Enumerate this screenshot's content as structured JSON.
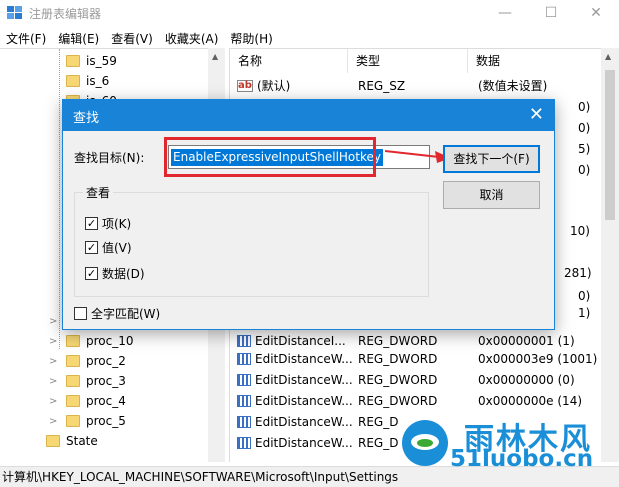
{
  "window": {
    "title": "注册表编辑器",
    "minimize": "—",
    "maximize": "☐",
    "close": "✕"
  },
  "menu": [
    "文件(F)",
    "编辑(E)",
    "查看(V)",
    "收藏夹(A)",
    "帮助(H)"
  ],
  "tree": {
    "top_items": [
      "is_59",
      "is_6",
      "is_60"
    ],
    "bottom_items": [
      "proc_10",
      "proc_2",
      "proc_3",
      "proc_4",
      "proc_5"
    ],
    "state": "State"
  },
  "columns": {
    "name": "名称",
    "type": "类型",
    "data": "数据"
  },
  "values": [
    {
      "icon": "string-value-icon",
      "name": "(默认)",
      "type": "REG_SZ",
      "data": "(数值未设置)"
    },
    {
      "icon": "dword-value-icon",
      "name": "",
      "type": "",
      "data": "0)"
    },
    {
      "icon": "dword-value-icon",
      "name": "",
      "type": "",
      "data": "0)"
    },
    {
      "icon": "dword-value-icon",
      "name": "",
      "type": "",
      "data": "5)"
    },
    {
      "icon": "dword-value-icon",
      "name": "",
      "type": "",
      "data": "0)"
    },
    {
      "icon": "dword-value-icon",
      "name": "",
      "type": "",
      "data": "10)"
    },
    {
      "icon": "dword-value-icon",
      "name": "",
      "type": "",
      "data": "281)"
    },
    {
      "icon": "dword-value-icon",
      "name": "",
      "type": "",
      "data": "0)"
    },
    {
      "icon": "dword-value-icon",
      "name": "",
      "type": "",
      "data": "1)"
    },
    {
      "icon": "dword-value-icon",
      "name": "EditDistanceI...",
      "type": "REG_DWORD",
      "data": "0x00000001 (1)"
    },
    {
      "icon": "dword-value-icon",
      "name": "EditDistanceW...",
      "type": "REG_DWORD",
      "data": "0x000003e9 (1001)"
    },
    {
      "icon": "dword-value-icon",
      "name": "EditDistanceW...",
      "type": "REG_DWORD",
      "data": "0x00000000 (0)"
    },
    {
      "icon": "dword-value-icon",
      "name": "EditDistanceW...",
      "type": "REG_DWORD",
      "data": "0x0000000e (14)"
    },
    {
      "icon": "dword-value-icon",
      "name": "EditDistanceW...",
      "type": "REG_D",
      "data": ""
    },
    {
      "icon": "dword-value-icon",
      "name": "EditDistanceW...",
      "type": "REG_D",
      "data": ""
    }
  ],
  "status": "计算机\\HKEY_LOCAL_MACHINE\\SOFTWARE\\Microsoft\\Input\\Settings",
  "dialog": {
    "title": "查找",
    "find_label": "查找目标(N):",
    "find_value": "EnableExpressiveInputShellHotkey",
    "find_next_label": "查找下一个(F)",
    "cancel_label": "取消",
    "look_at_label": "查看",
    "options": [
      {
        "label": "项(K)",
        "checked": true
      },
      {
        "label": "值(V)",
        "checked": true
      },
      {
        "label": "数据(D)",
        "checked": true
      }
    ],
    "match_whole_label": "全字匹配(W)",
    "match_whole_checked": false,
    "highlight_color": "#e0282e",
    "accent_color": "#1883d7"
  },
  "watermark": {
    "name_cn": "雨林木风",
    "domain": "51luobo.cn"
  }
}
